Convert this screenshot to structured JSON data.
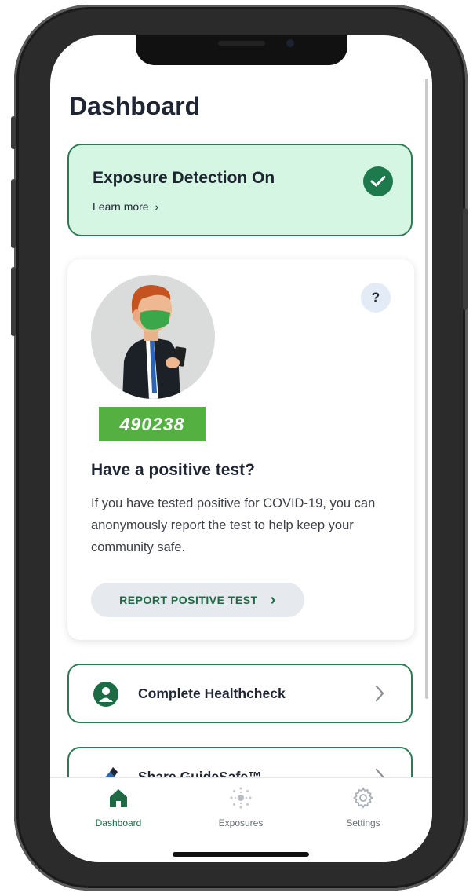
{
  "header": {
    "title": "Dashboard"
  },
  "exposure": {
    "title": "Exposure Detection On",
    "link": "Learn more",
    "link_chevron": "›",
    "status_icon": "check-circle-icon",
    "accent": "#1d7a4d"
  },
  "report_card": {
    "help_label": "?",
    "code": "490238",
    "heading": "Have a positive test?",
    "body": "If you have tested positive for COVID-19, you can anonymously report the test to help keep your community safe.",
    "button_label": "REPORT POSITIVE TEST",
    "button_chevron": "›"
  },
  "list_items": [
    {
      "label": "Complete Healthcheck",
      "icon": "healthcheck-icon"
    },
    {
      "label": "Share GuideSafe™",
      "icon": "share-icon"
    }
  ],
  "tabs": [
    {
      "label": "Dashboard",
      "icon": "home-icon",
      "active": true,
      "color": "#1e6a45"
    },
    {
      "label": "Exposures",
      "icon": "exposures-icon",
      "active": false,
      "color": "#6b7078"
    },
    {
      "label": "Settings",
      "icon": "gear-icon",
      "active": false,
      "color": "#6b7078"
    }
  ]
}
